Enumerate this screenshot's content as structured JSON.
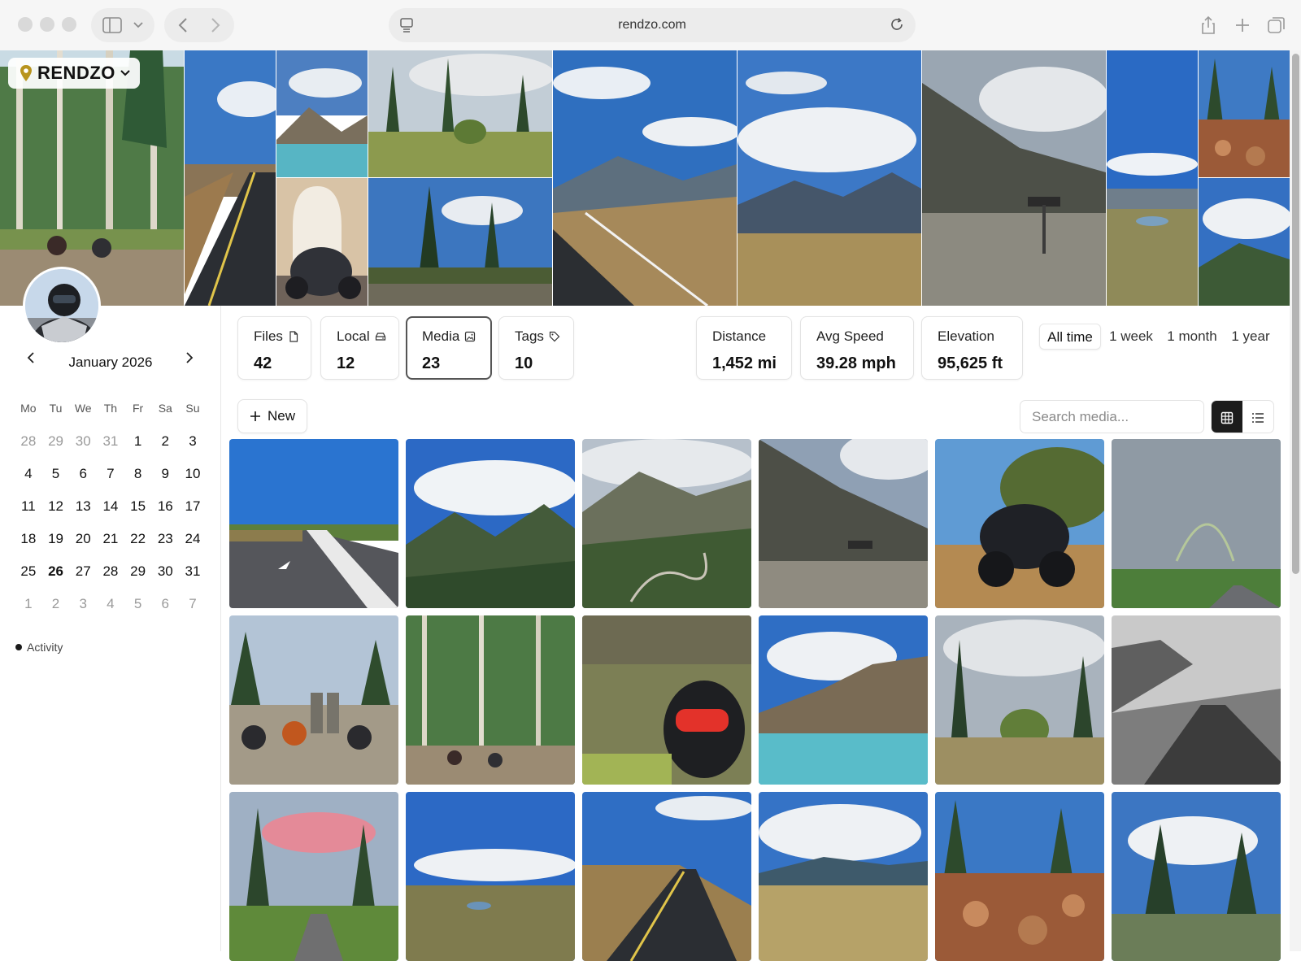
{
  "browser": {
    "url": "rendzo.com"
  },
  "brand": {
    "name": "RENDZO"
  },
  "calendar": {
    "month_label": "January 2026",
    "weekdays": [
      "Mo",
      "Tu",
      "We",
      "Th",
      "Fr",
      "Sa",
      "Su"
    ],
    "weeks": [
      [
        "28",
        "29",
        "30",
        "31",
        "1",
        "2",
        "3"
      ],
      [
        "4",
        "5",
        "6",
        "7",
        "8",
        "9",
        "10"
      ],
      [
        "11",
        "12",
        "13",
        "14",
        "15",
        "16",
        "17"
      ],
      [
        "18",
        "19",
        "20",
        "21",
        "22",
        "23",
        "24"
      ],
      [
        "25",
        "26",
        "27",
        "28",
        "29",
        "30",
        "31"
      ],
      [
        "1",
        "2",
        "3",
        "4",
        "5",
        "6",
        "7"
      ]
    ],
    "today": "26",
    "legend_label": "Activity"
  },
  "stats": {
    "files": {
      "label": "Files",
      "value": "42"
    },
    "local": {
      "label": "Local",
      "value": "12"
    },
    "media": {
      "label": "Media",
      "value": "23"
    },
    "tags": {
      "label": "Tags",
      "value": "10"
    },
    "distance": {
      "label": "Distance",
      "value": "1,452 mi"
    },
    "avg_speed": {
      "label": "Avg Speed",
      "value": "39.28 mph"
    },
    "elevation": {
      "label": "Elevation",
      "value": "95,625 ft"
    }
  },
  "time_ranges": {
    "options": [
      "All time",
      "1 week",
      "1 month",
      "1 year"
    ],
    "selected": "All time"
  },
  "toolbar": {
    "new_label": "New",
    "search_placeholder": "Search media...",
    "view_selected": "grid"
  }
}
